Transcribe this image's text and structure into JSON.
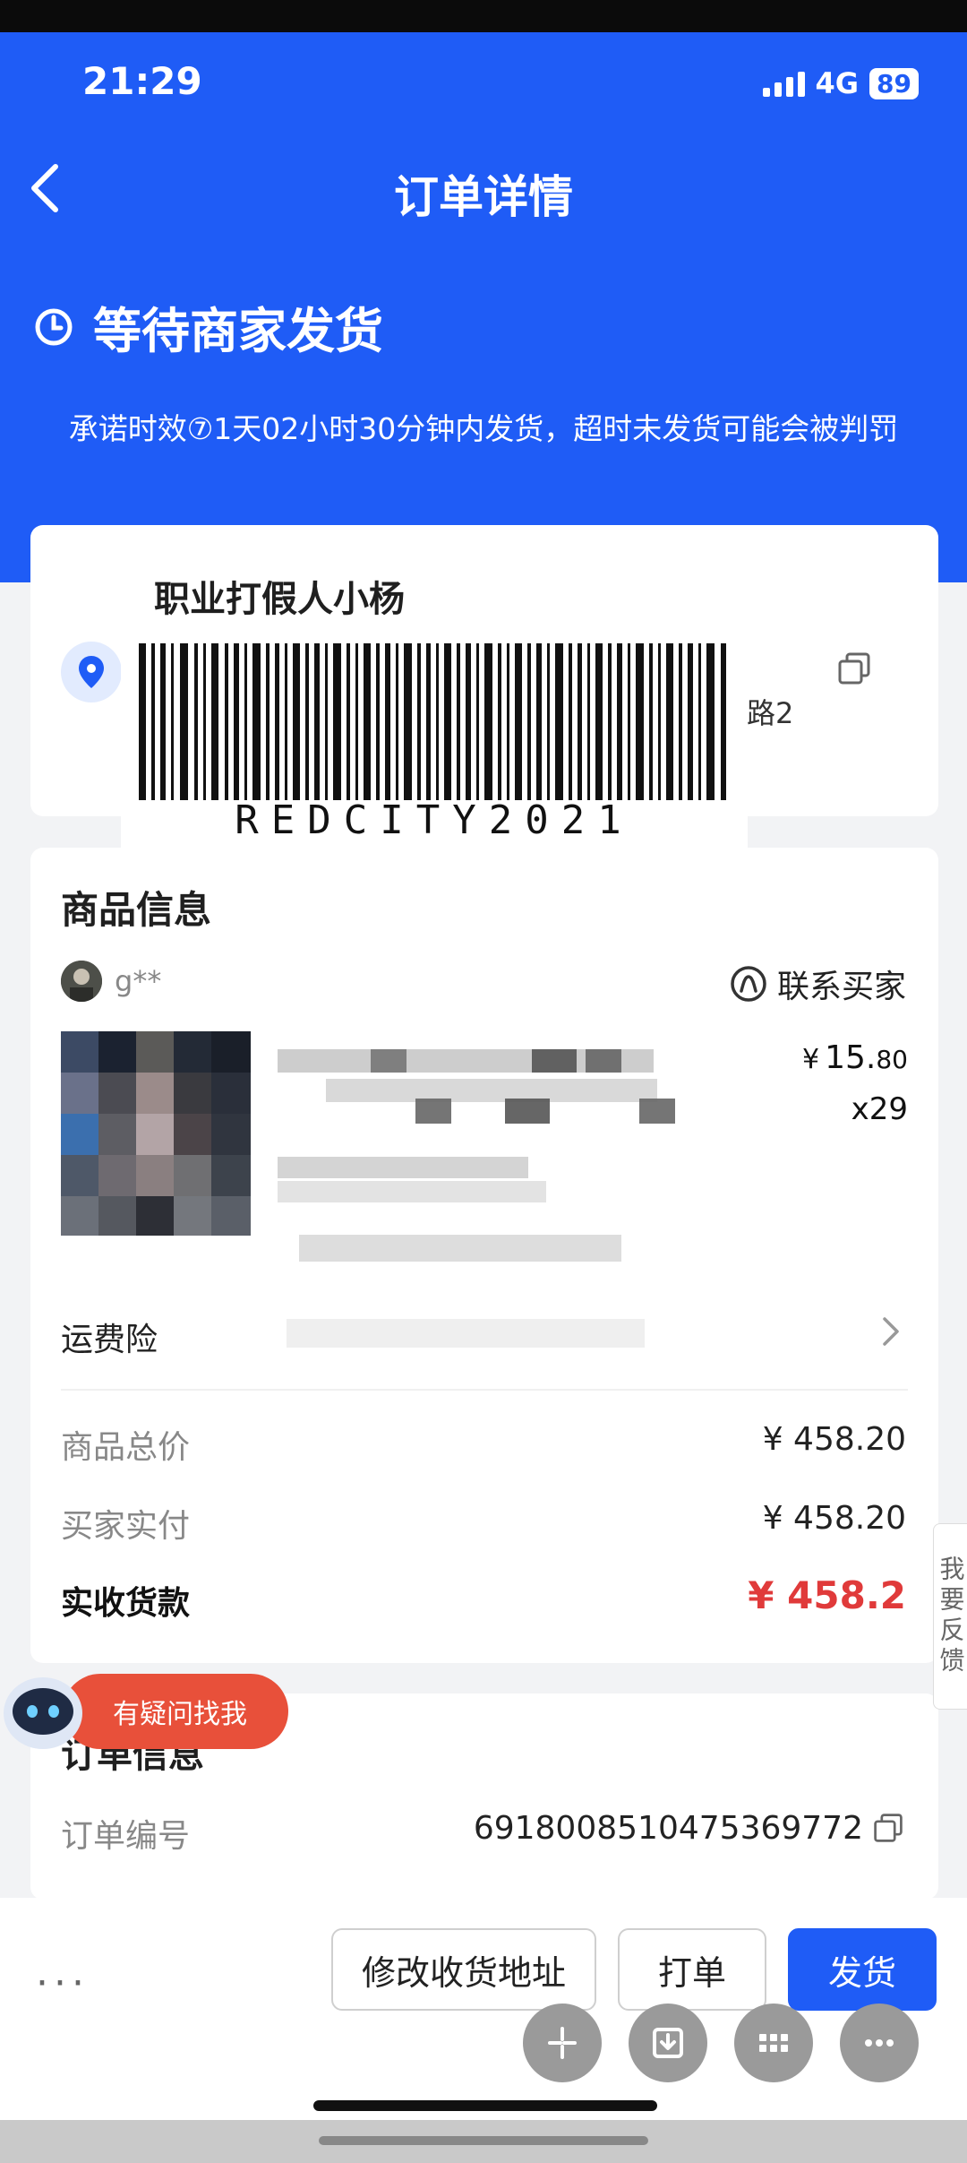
{
  "status_bar": {
    "time": "21:29",
    "network": "4G",
    "battery": "89"
  },
  "header": {
    "title": "订单详情"
  },
  "order_status": {
    "title": "等待商家发货",
    "promise": "承诺时效⑦1天02小时30分钟内发货，超时未发货可能会被判罚"
  },
  "address": {
    "name": "职业打假人小杨",
    "address_visible": "路2",
    "barcode_text": "REDCITY2021"
  },
  "goods": {
    "section_title": "商品信息",
    "seller_name": "g**",
    "contact_label": "联系买家",
    "price_int": "15.",
    "price_cents": "80",
    "currency": "¥",
    "quantity": "x29",
    "insurance_label": "运费险"
  },
  "totals": {
    "goods_total_label": "商品总价",
    "goods_total_value": "¥ 458.20",
    "buyer_paid_label": "买家实付",
    "buyer_paid_value": "¥ 458.20",
    "received_label": "实收货款",
    "received_value": "¥ 458.2"
  },
  "order_info": {
    "section_title": "订单信息",
    "order_no_label": "订单编号",
    "order_no_value": "6918008510475369772"
  },
  "feedback": {
    "label": "我要反馈"
  },
  "help": {
    "label": "有疑问找我"
  },
  "actions": {
    "more": "···",
    "modify_address": "修改收货地址",
    "print": "打单",
    "ship": "发货"
  },
  "colors": {
    "brand_blue": "#1f5cf6",
    "price_red": "#e03a3a"
  }
}
